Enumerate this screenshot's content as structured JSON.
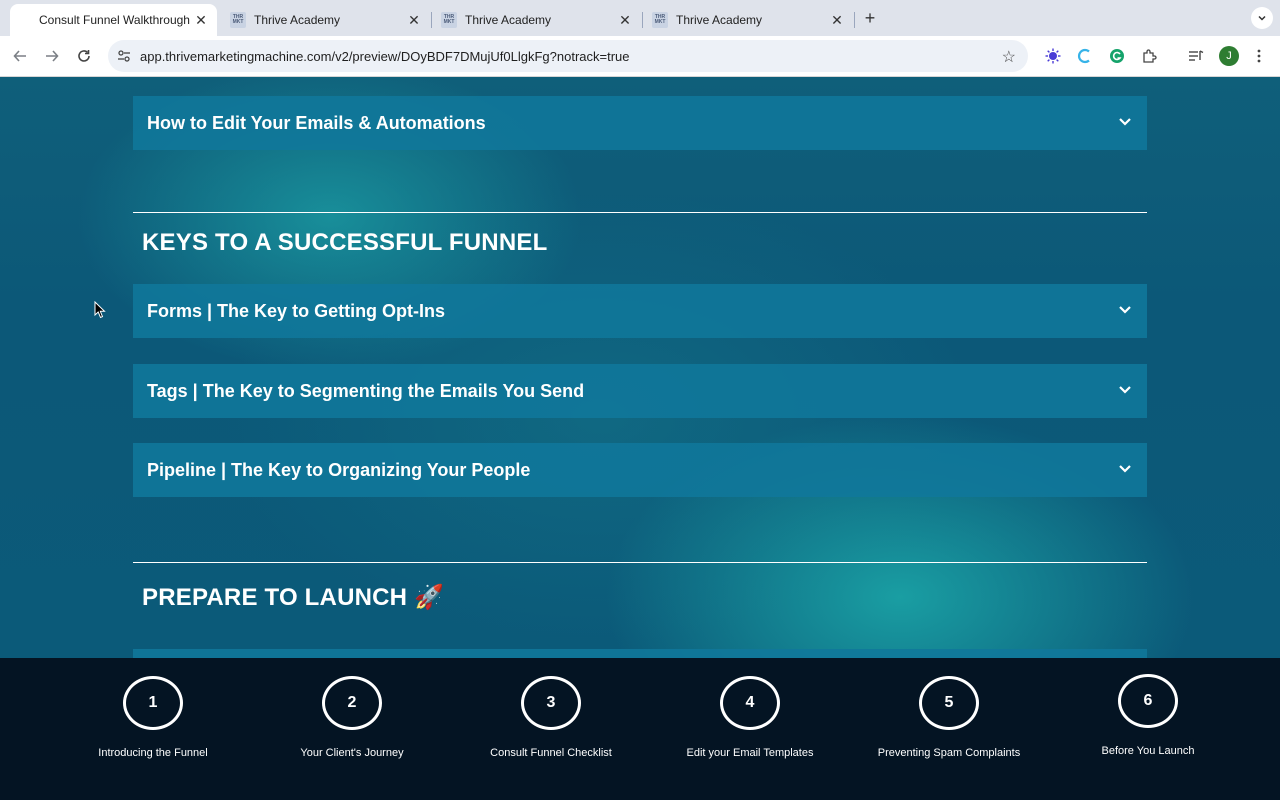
{
  "browser": {
    "tabs": [
      {
        "title": "Consult Funnel Walkthrough (",
        "active": true
      },
      {
        "title": "Thrive Academy",
        "active": false,
        "favicon_text": "THRIVE MKTNG"
      },
      {
        "title": "Thrive Academy",
        "active": false,
        "favicon_text": "THRIVE MKTNG"
      },
      {
        "title": "Thrive Academy",
        "active": false,
        "favicon_text": "THRIVE MKTNG"
      }
    ],
    "url": "app.thrivemarketingmachine.com/v2/preview/DOyBDF7DMujUf0LlgkFg?notrack=true",
    "profile_initial": "J"
  },
  "page": {
    "top_accordion": "How to Edit Your Emails & Automations",
    "sections": [
      {
        "heading": "KEYS TO A SUCCESSFUL FUNNEL",
        "items": [
          "Forms | The Key to Getting Opt-Ins",
          "Tags | The Key to Segmenting the Emails You Send",
          "Pipeline | The Key to Organizing Your People"
        ]
      },
      {
        "heading": "PREPARE TO LAUNCH 🚀"
      }
    ]
  },
  "steps": [
    {
      "number": "1",
      "label": "Introducing the Funnel"
    },
    {
      "number": "2",
      "label": "Your Client's Journey"
    },
    {
      "number": "3",
      "label": "Consult Funnel Checklist"
    },
    {
      "number": "4",
      "label": "Edit your Email Templates"
    },
    {
      "number": "5",
      "label": "Preventing Spam Complaints"
    },
    {
      "number": "6",
      "label": "Before You Launch"
    }
  ],
  "colors": {
    "accordion_bg": "#10789b",
    "stepbar_bg": "#041423",
    "page_teal": "#1caaaa"
  },
  "icons": {
    "back": "arrow-left-icon",
    "forward": "arrow-right-icon",
    "reload": "reload-icon",
    "bookmark": "star-icon",
    "accordion": "chevron-down-icon"
  }
}
